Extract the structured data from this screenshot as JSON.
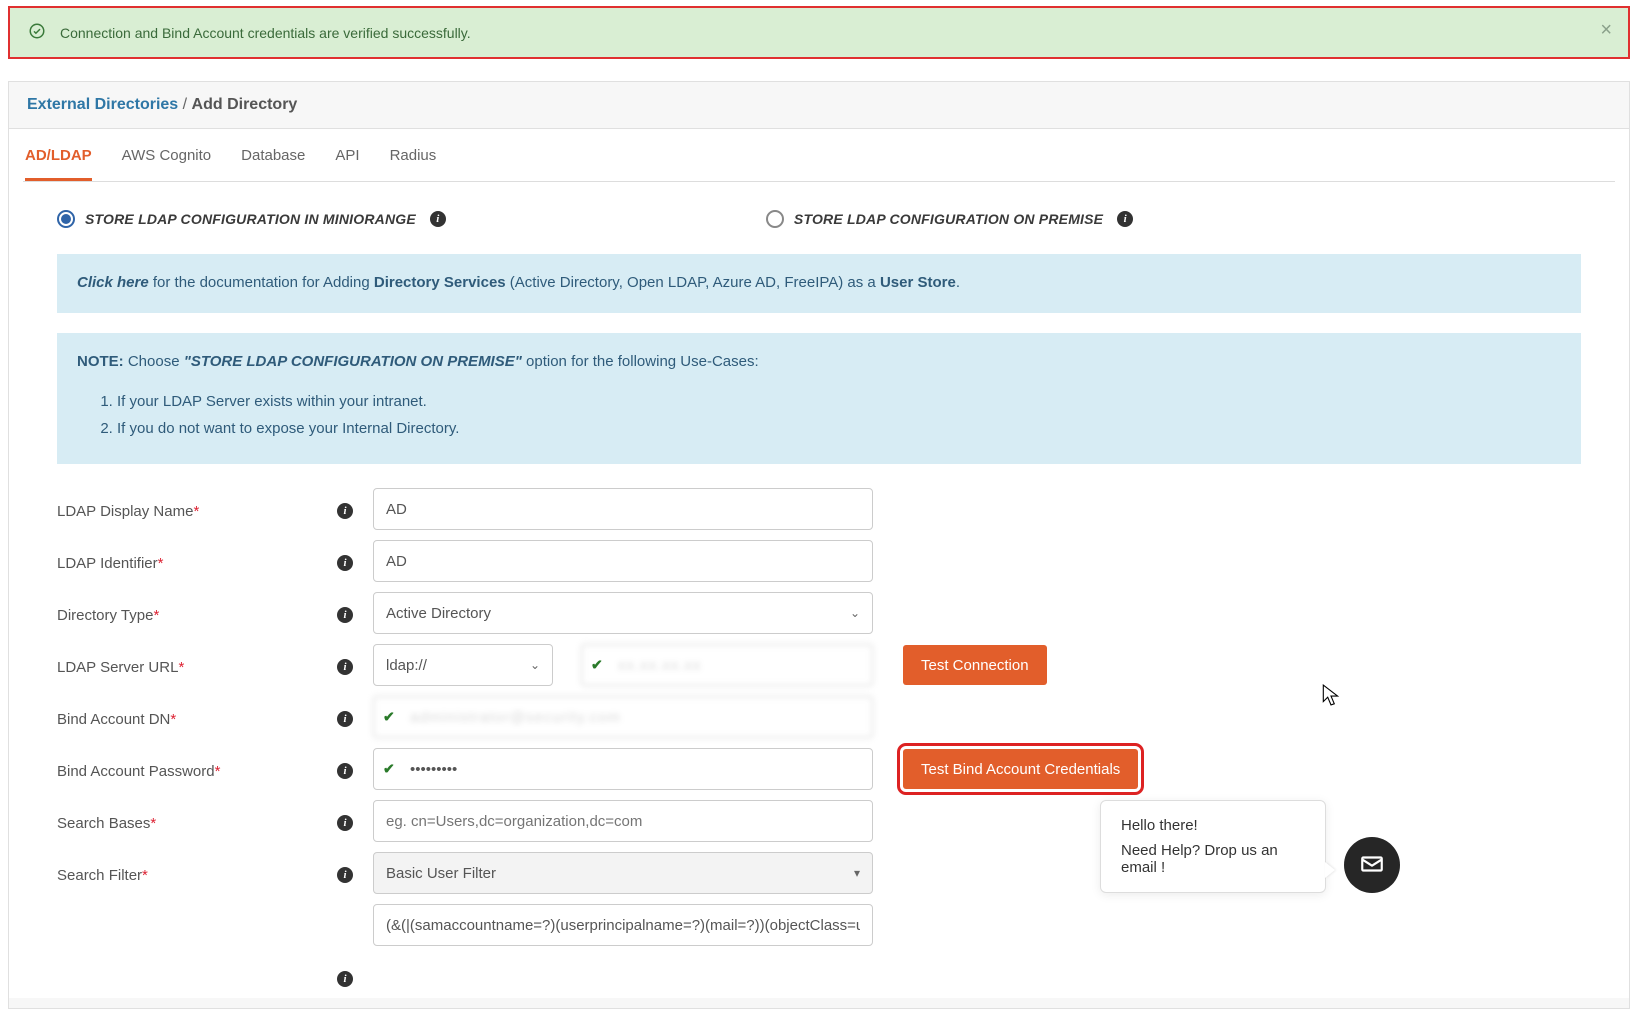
{
  "alert": {
    "text": "Connection and Bind Account credentials are verified successfully."
  },
  "breadcrumb": {
    "link": "External Directories",
    "sep": " / ",
    "current": "Add Directory"
  },
  "tabs": [
    "AD/LDAP",
    "AWS Cognito",
    "Database",
    "API",
    "Radius"
  ],
  "radios": {
    "opt1": "STORE LDAP CONFIGURATION IN MINIORANGE",
    "opt2": "STORE LDAP CONFIGURATION ON PREMISE"
  },
  "doc_note": {
    "click_here": "Click here",
    "txt1": " for the documentation for Adding ",
    "dir_services": "Directory Services",
    "txt2": " (Active Directory, Open LDAP, Azure AD, FreeIPA) as a ",
    "user_store": "User Store",
    "txt3": "."
  },
  "usecase_note": {
    "note": "NOTE:",
    "choose": "  Choose ",
    "emph": "\"STORE LDAP CONFIGURATION ON PREMISE\"",
    "tail": " option for the following Use-Cases:",
    "items": [
      "If your LDAP Server exists within your intranet.",
      "If you do not want to expose your Internal Directory."
    ]
  },
  "form": {
    "display_name": {
      "label": "LDAP Display Name",
      "value": "AD"
    },
    "identifier": {
      "label": "LDAP Identifier",
      "value": "AD"
    },
    "dir_type": {
      "label": "Directory Type",
      "value": "Active Directory"
    },
    "server_url": {
      "label": "LDAP Server URL",
      "scheme": "ldap://",
      "host_blur": "xx.xx.xx.xx"
    },
    "bind_dn": {
      "label": "Bind Account DN",
      "value_blur": "administrator@security.com"
    },
    "bind_pw": {
      "label": "Bind Account Password",
      "value": "•••••••••"
    },
    "search_base": {
      "label": "Search Bases",
      "placeholder": "eg. cn=Users,dc=organization,dc=com"
    },
    "search_filter": {
      "label": "Search Filter",
      "value": "Basic User Filter",
      "expr": "(&(|(samaccountname=?)(userprincipalname=?)(mail=?))(objectClass=user))"
    }
  },
  "buttons": {
    "test_conn": "Test Connection",
    "test_bind": "Test Bind Account Credentials"
  },
  "chat": {
    "line1": "Hello there!",
    "line2": "Need Help? Drop us an email !"
  }
}
